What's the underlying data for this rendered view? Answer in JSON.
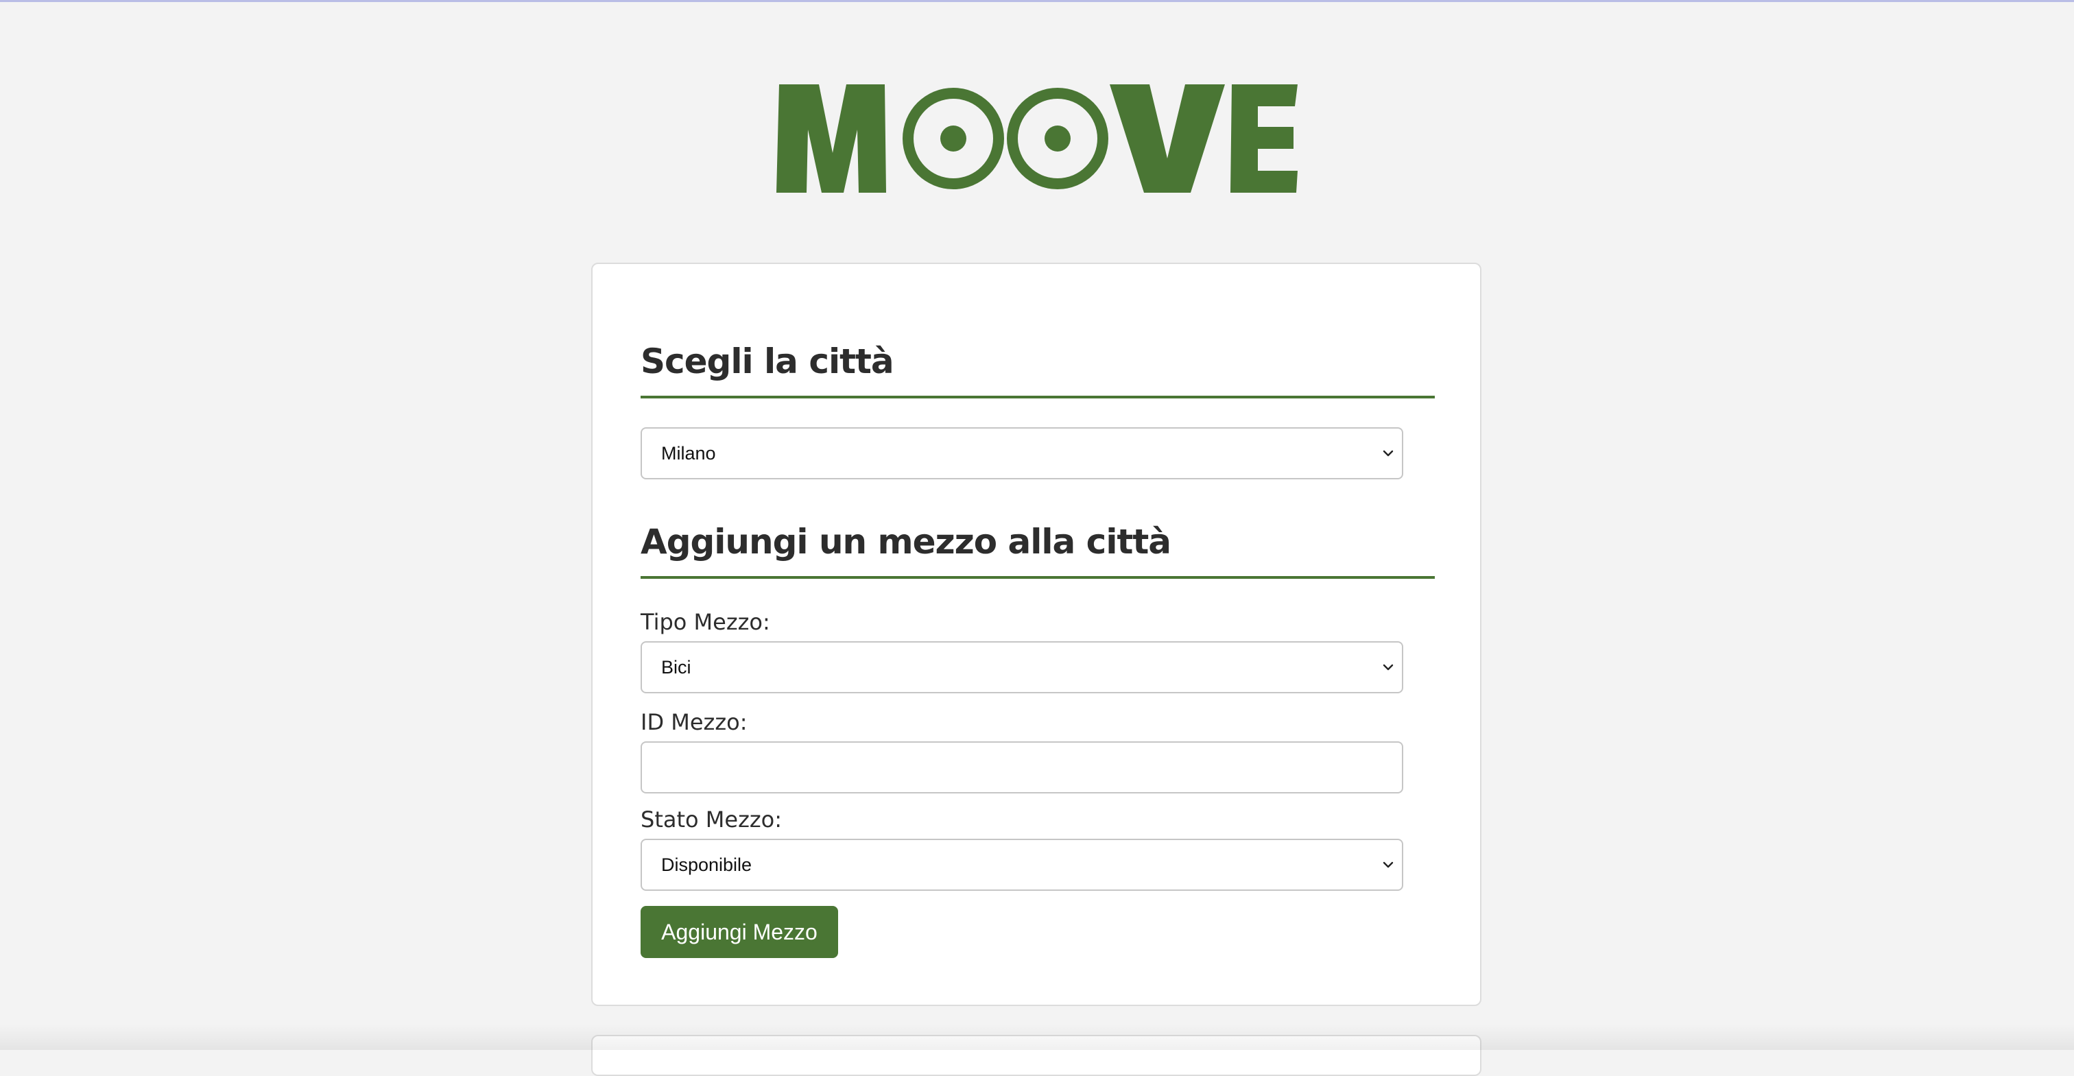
{
  "brand": {
    "logo_text": "MOOVE",
    "color": "#4a7634"
  },
  "city_section": {
    "title": "Scegli la città",
    "city_select": {
      "value": "Milano",
      "icon": "chevron-down-icon"
    }
  },
  "vehicle_section": {
    "title": "Aggiungi un mezzo alla città",
    "type": {
      "label": "Tipo Mezzo:",
      "value": "Bici"
    },
    "id": {
      "label": "ID Mezzo:",
      "value": "",
      "placeholder": ""
    },
    "status": {
      "label": "Stato Mezzo:",
      "value": "Disponibile"
    },
    "submit_label": "Aggiungi Mezzo"
  },
  "colors": {
    "accent": "#4a7634",
    "background": "#f3f3f3",
    "card": "#ffffff",
    "heading": "#2d2d2d"
  }
}
